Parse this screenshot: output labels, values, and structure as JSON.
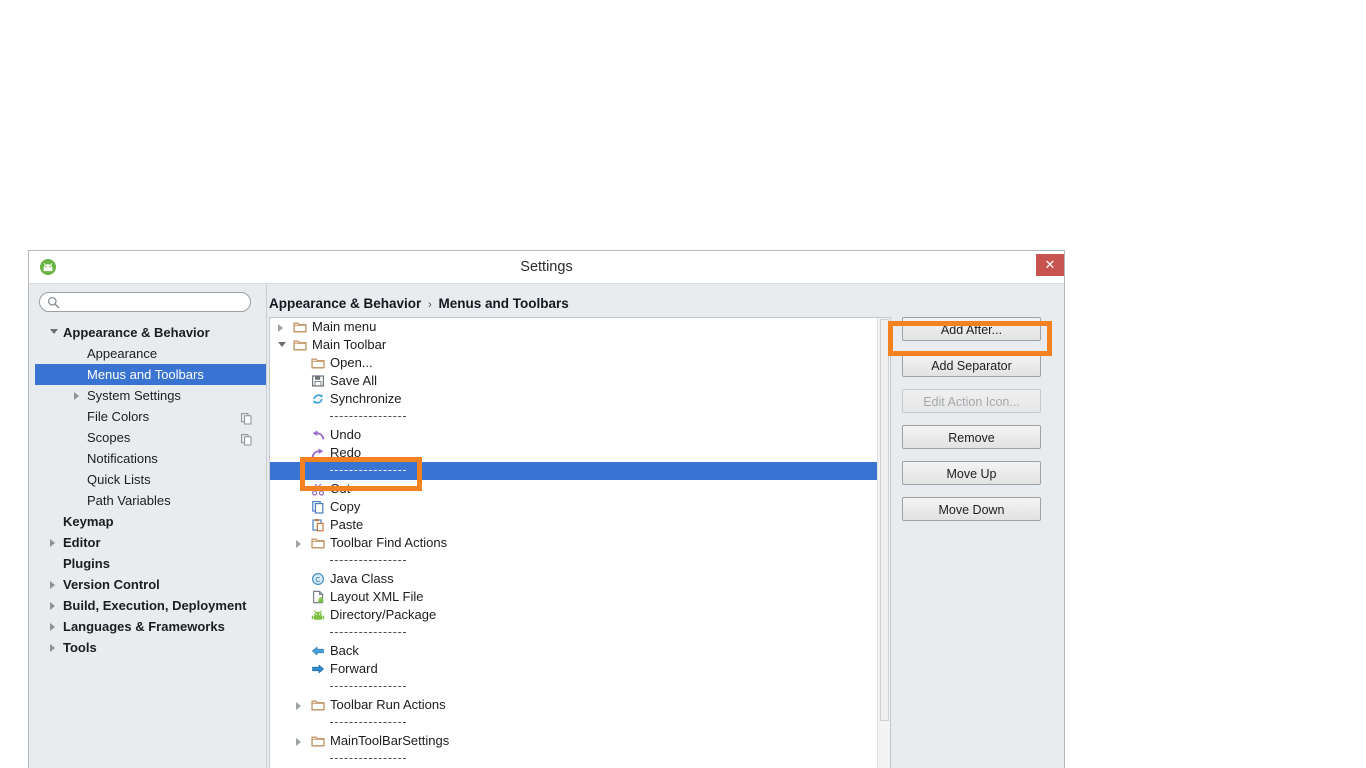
{
  "window": {
    "title": "Settings",
    "app_icon": "android-studio-icon",
    "close_label": "✕"
  },
  "search": {
    "value": "",
    "placeholder": "",
    "icon": "search-icon"
  },
  "sidebar": {
    "items": [
      {
        "label": "Appearance & Behavior",
        "level": 0,
        "arrow": "open",
        "selected": false,
        "badge": false
      },
      {
        "label": "Appearance",
        "level": 1,
        "arrow": "none",
        "selected": false,
        "badge": false
      },
      {
        "label": "Menus and Toolbars",
        "level": 1,
        "arrow": "none",
        "selected": true,
        "badge": false
      },
      {
        "label": "System Settings",
        "level": 1,
        "arrow": "closed",
        "selected": false,
        "badge": false
      },
      {
        "label": "File Colors",
        "level": 1,
        "arrow": "none",
        "selected": false,
        "badge": true
      },
      {
        "label": "Scopes",
        "level": 1,
        "arrow": "none",
        "selected": false,
        "badge": true
      },
      {
        "label": "Notifications",
        "level": 1,
        "arrow": "none",
        "selected": false,
        "badge": false
      },
      {
        "label": "Quick Lists",
        "level": 1,
        "arrow": "none",
        "selected": false,
        "badge": false
      },
      {
        "label": "Path Variables",
        "level": 1,
        "arrow": "none",
        "selected": false,
        "badge": false
      },
      {
        "label": "Keymap",
        "level": 0,
        "arrow": "none",
        "selected": false,
        "badge": false
      },
      {
        "label": "Editor",
        "level": 0,
        "arrow": "closed",
        "selected": false,
        "badge": false
      },
      {
        "label": "Plugins",
        "level": 0,
        "arrow": "none",
        "selected": false,
        "badge": false
      },
      {
        "label": "Version Control",
        "level": 0,
        "arrow": "closed",
        "selected": false,
        "badge": false
      },
      {
        "label": "Build, Execution, Deployment",
        "level": 0,
        "arrow": "closed",
        "selected": false,
        "badge": false
      },
      {
        "label": "Languages & Frameworks",
        "level": 0,
        "arrow": "closed",
        "selected": false,
        "badge": false
      },
      {
        "label": "Tools",
        "level": 0,
        "arrow": "closed",
        "selected": false,
        "badge": false
      }
    ]
  },
  "breadcrumb": {
    "root": "Appearance & Behavior",
    "separator": "›",
    "current": "Menus and Toolbars"
  },
  "tree": {
    "rows": [
      {
        "label": "Main menu",
        "depth": 0,
        "arrow": "closed",
        "icon": "folder-icon",
        "type": "node",
        "selected": false
      },
      {
        "label": "Main Toolbar",
        "depth": 0,
        "arrow": "open",
        "icon": "folder-icon",
        "type": "node",
        "selected": false
      },
      {
        "label": "Open...",
        "depth": 1,
        "arrow": "none",
        "icon": "folder-open-icon",
        "type": "node",
        "selected": false
      },
      {
        "label": "Save All",
        "depth": 1,
        "arrow": "none",
        "icon": "save-all-icon",
        "type": "node",
        "selected": false
      },
      {
        "label": "Synchronize",
        "depth": 1,
        "arrow": "none",
        "icon": "synchronize-icon",
        "type": "node",
        "selected": false
      },
      {
        "label": "------------",
        "depth": 1,
        "arrow": "none",
        "icon": "none",
        "type": "separator",
        "selected": false
      },
      {
        "label": "Undo",
        "depth": 1,
        "arrow": "none",
        "icon": "undo-icon",
        "type": "node",
        "selected": false
      },
      {
        "label": "Redo",
        "depth": 1,
        "arrow": "none",
        "icon": "redo-icon",
        "type": "node",
        "selected": false
      },
      {
        "label": "------------",
        "depth": 1,
        "arrow": "none",
        "icon": "none",
        "type": "separator",
        "selected": true
      },
      {
        "label": "Cut",
        "depth": 1,
        "arrow": "none",
        "icon": "cut-icon",
        "type": "node",
        "selected": false
      },
      {
        "label": "Copy",
        "depth": 1,
        "arrow": "none",
        "icon": "copy-icon",
        "type": "node",
        "selected": false
      },
      {
        "label": "Paste",
        "depth": 1,
        "arrow": "none",
        "icon": "paste-icon",
        "type": "node",
        "selected": false
      },
      {
        "label": "Toolbar Find Actions",
        "depth": 1,
        "arrow": "closed",
        "icon": "folder-icon",
        "type": "node",
        "selected": false
      },
      {
        "label": "------------",
        "depth": 1,
        "arrow": "none",
        "icon": "none",
        "type": "separator",
        "selected": false
      },
      {
        "label": "Java Class",
        "depth": 1,
        "arrow": "none",
        "icon": "java-class-icon",
        "type": "node",
        "selected": false
      },
      {
        "label": "Layout XML File",
        "depth": 1,
        "arrow": "none",
        "icon": "layout-xml-icon",
        "type": "node",
        "selected": false
      },
      {
        "label": "Directory/Package",
        "depth": 1,
        "arrow": "none",
        "icon": "android-package-icon",
        "type": "node",
        "selected": false
      },
      {
        "label": "------------",
        "depth": 1,
        "arrow": "none",
        "icon": "none",
        "type": "separator",
        "selected": false
      },
      {
        "label": "Back",
        "depth": 1,
        "arrow": "none",
        "icon": "back-arrow-icon",
        "type": "node",
        "selected": false
      },
      {
        "label": "Forward",
        "depth": 1,
        "arrow": "none",
        "icon": "forward-arrow-icon",
        "type": "node",
        "selected": false
      },
      {
        "label": "------------",
        "depth": 1,
        "arrow": "none",
        "icon": "none",
        "type": "separator",
        "selected": false
      },
      {
        "label": "Toolbar Run Actions",
        "depth": 1,
        "arrow": "closed",
        "icon": "folder-icon",
        "type": "node",
        "selected": false
      },
      {
        "label": "------------",
        "depth": 1,
        "arrow": "none",
        "icon": "none",
        "type": "separator",
        "selected": false
      },
      {
        "label": "MainToolBarSettings",
        "depth": 1,
        "arrow": "closed",
        "icon": "folder-icon",
        "type": "node",
        "selected": false
      },
      {
        "label": "------------",
        "depth": 1,
        "arrow": "none",
        "icon": "none",
        "type": "separator",
        "selected": false
      }
    ]
  },
  "buttons": [
    {
      "label": "Add After...",
      "disabled": false,
      "highlighted": true
    },
    {
      "label": "Add Separator",
      "disabled": false,
      "highlighted": false
    },
    {
      "label": "Edit Action Icon...",
      "disabled": true,
      "highlighted": false
    },
    {
      "label": "Remove",
      "disabled": false,
      "highlighted": false
    },
    {
      "label": "Move Up",
      "disabled": false,
      "highlighted": false
    },
    {
      "label": "Move Down",
      "disabled": false,
      "highlighted": false
    }
  ],
  "colors": {
    "selection_blue": "#3a74d2",
    "highlight_orange": "#f58220",
    "close_red": "#c75450",
    "panel_gray": "#e8ecef",
    "folder_tan": "#c49a6c"
  }
}
